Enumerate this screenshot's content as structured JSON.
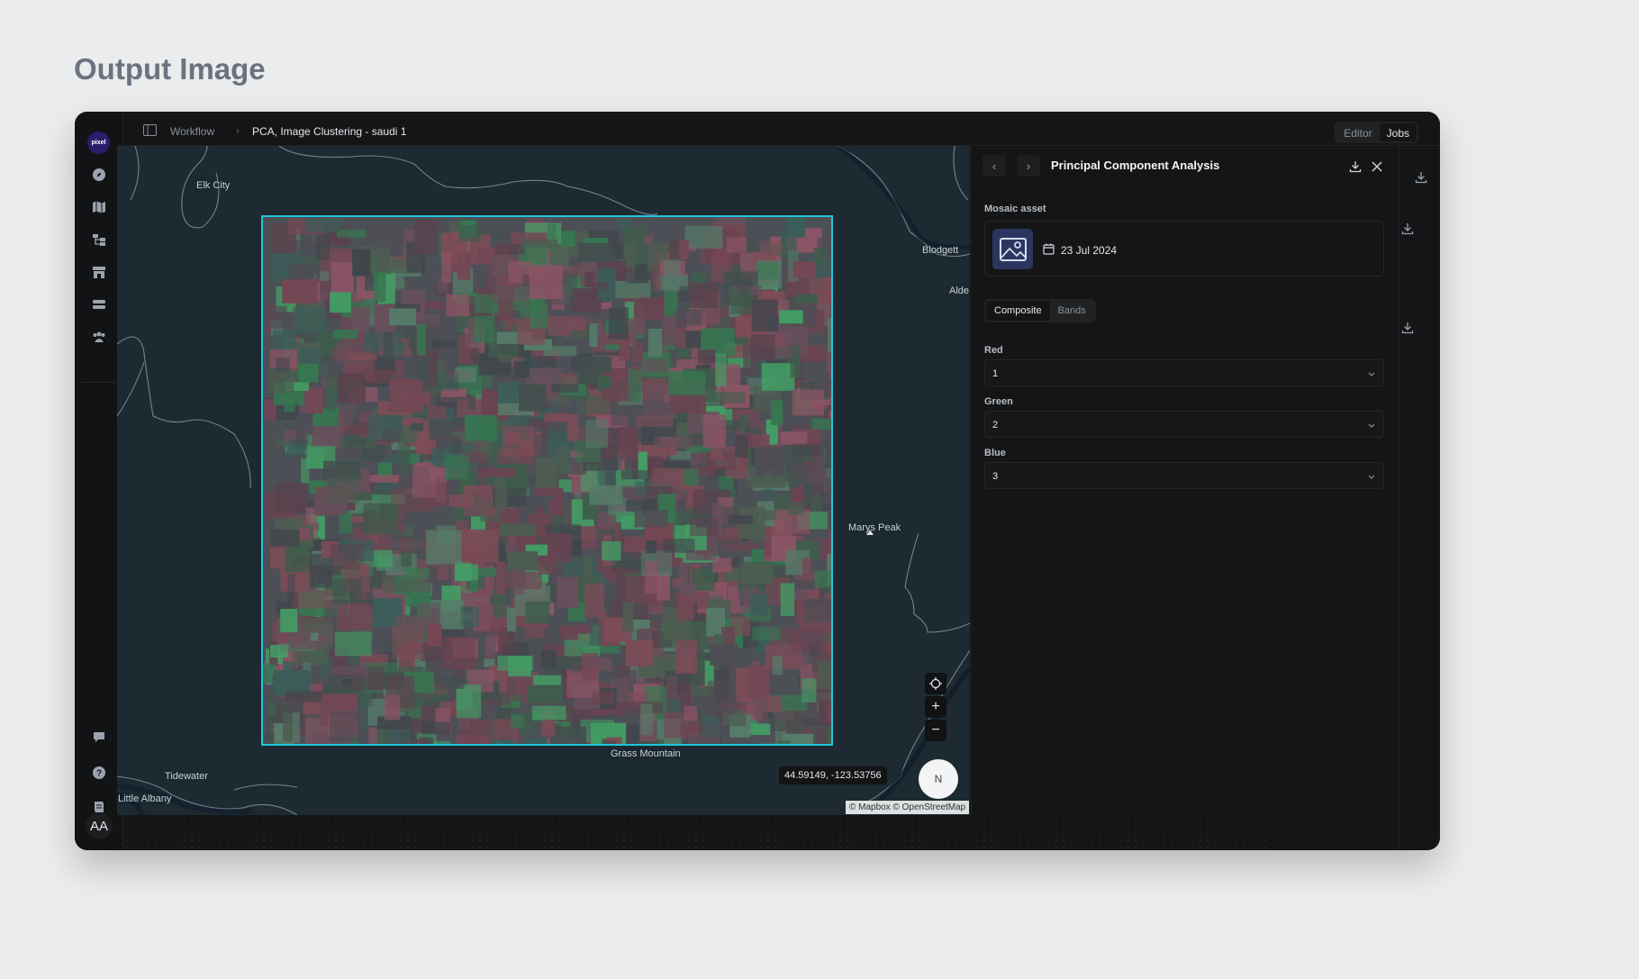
{
  "page": {
    "heading": "Output Image"
  },
  "rail": {
    "logo": "pixel",
    "avatar": "AA"
  },
  "topbar": {
    "breadcrumb_root": "Workflow",
    "breadcrumb_sep": "›",
    "breadcrumb_current": "PCA, Image Clustering - saudi 1",
    "tabs": [
      {
        "label": "Editor",
        "active": false
      },
      {
        "label": "Jobs",
        "active": true
      }
    ]
  },
  "map": {
    "labels": {
      "elk_city": "Elk City",
      "blodgett": "Blodgett",
      "alder": "Alde",
      "marys_peak": "Marys Peak",
      "grass_mountain": "Grass Mountain",
      "tidewater": "Tidewater",
      "little_albany": "Little Albany"
    },
    "coordinates": "44.59149, -123.53756",
    "compass": "N",
    "attribution": "© Mapbox © OpenStreetMap",
    "zoom_in": "+",
    "zoom_out": "−",
    "outline_color": "#22c3dc"
  },
  "panel": {
    "title": "Principal Component Analysis",
    "nav_prev": "‹",
    "nav_next": "›",
    "mosaic_label": "Mosaic asset",
    "asset_date": "23 Jul 2024",
    "segment": [
      {
        "label": "Composite",
        "active": true
      },
      {
        "label": "Bands",
        "active": false
      }
    ],
    "red_label": "Red",
    "red_value": "1",
    "green_label": "Green",
    "green_value": "2",
    "blue_label": "Blue",
    "blue_value": "3"
  }
}
